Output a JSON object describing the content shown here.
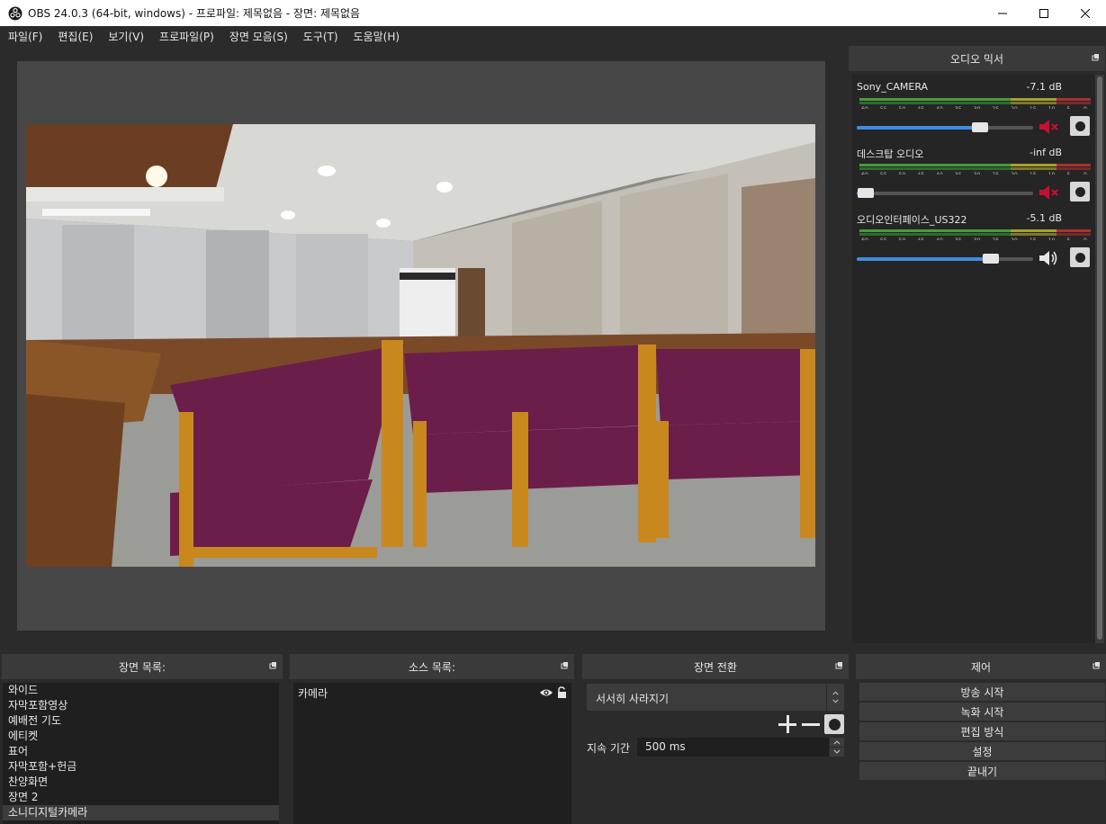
{
  "window": {
    "title": "OBS 24.0.3 (64-bit, windows) - 프로파일: 제목없음 - 장면: 제목없음"
  },
  "menu": [
    "파일(F)",
    "편집(E)",
    "보기(V)",
    "프로파일(P)",
    "장면 모음(S)",
    "도구(T)",
    "도움말(H)"
  ],
  "mixer": {
    "title": "오디오 믹서",
    "scale": [
      "-60",
      "-55",
      "-50",
      "-45",
      "-40",
      "-35",
      "-30",
      "-25",
      "-20",
      "-15",
      "-10",
      "-5",
      "0"
    ],
    "channels": [
      {
        "name": "Sony_CAMERA",
        "db": "-7.1 dB",
        "volume": 0.7,
        "muted": true
      },
      {
        "name": "데스크탑 오디오",
        "db": "-inf dB",
        "volume": 0.05,
        "muted": true
      },
      {
        "name": "오디오인터페이스_US322",
        "db": "-5.1 dB",
        "volume": 0.76,
        "muted": false
      }
    ]
  },
  "scenes": {
    "title": "장면 목록:",
    "items": [
      "와이드",
      "자막포함영상",
      "예배전 기도",
      "에티켓",
      "표어",
      "자막포함+헌금",
      "찬양화면",
      "장면 2",
      "소니디지털카메라"
    ],
    "selected_index": 8
  },
  "sources": {
    "title": "소스 목록:",
    "items": [
      "카메라"
    ]
  },
  "transitions": {
    "title": "장면 전환",
    "selected": "서서히 사라지기",
    "duration_label": "지속 기간",
    "duration_value": "500 ms"
  },
  "controls": {
    "title": "제어",
    "buttons": [
      "방송 시작",
      "녹화 시작",
      "편집 방식",
      "설정",
      "끝내기"
    ]
  },
  "colors": {
    "background": "#2b2b2b",
    "dock_title": "#3a3a3a",
    "list_bg": "#1f1f1f",
    "accent": "#3e8de0",
    "mute_red": "#c8102e"
  }
}
